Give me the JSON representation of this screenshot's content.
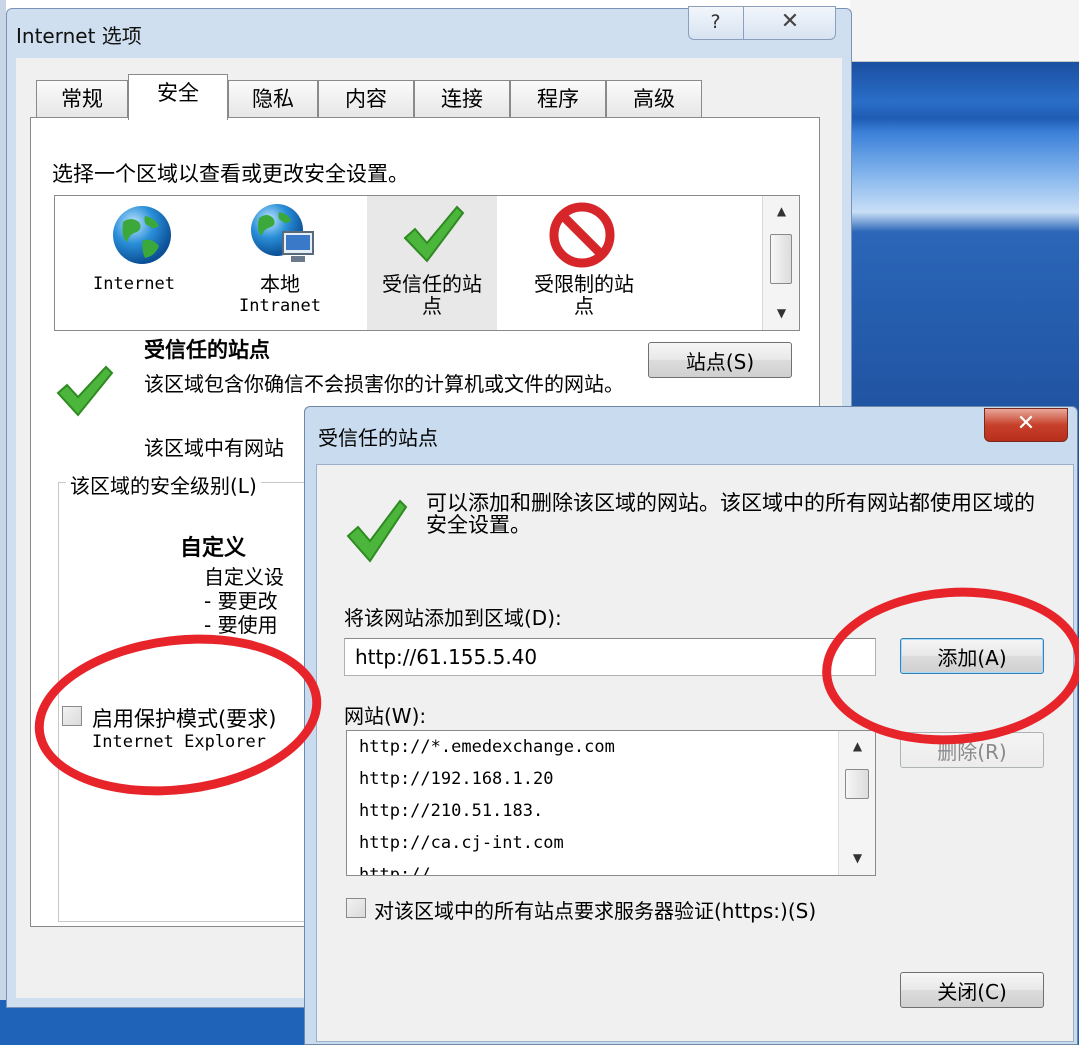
{
  "main_dialog": {
    "title": "Internet 选项",
    "help_glyph": "?",
    "close_glyph": "✕",
    "tabs": [
      {
        "label": "常规"
      },
      {
        "label": "安全"
      },
      {
        "label": "隐私"
      },
      {
        "label": "内容"
      },
      {
        "label": "连接"
      },
      {
        "label": "程序"
      },
      {
        "label": "高级"
      }
    ],
    "active_tab": "安全",
    "zone_prompt": "选择一个区域以查看或更改安全设置。",
    "zones": [
      {
        "label_line1": "Internet",
        "label_line2": "",
        "icon": "globe-icon"
      },
      {
        "label_line1": "本地",
        "label_line2": "Intranet",
        "icon": "network-globe-icon"
      },
      {
        "label_line1": "受信任的站",
        "label_line2": "点",
        "icon": "green-check-icon"
      },
      {
        "label_line1": "受限制的站",
        "label_line2": "点",
        "icon": "red-prohibited-icon"
      }
    ],
    "selected_zone": "受信任的站点",
    "section_title": "受信任的站点",
    "sites_button": "站点(S)",
    "description": "该区域包含你确信不会损害你的计算机或文件的网站。",
    "description2": "该区域中有网站",
    "security_level_label": "该区域的安全级别(L)",
    "level_title": "自定义",
    "level_lines": [
      "自定义设",
      "- 要更改",
      "- 要使用"
    ],
    "protected_mode_label": "启用保护模式(要求)",
    "protected_mode_label2": "Internet Explorer",
    "protected_mode_checked": false
  },
  "sites_dialog": {
    "title": "受信任的站点",
    "close_glyph": "✕",
    "description": "可以添加和删除该区域的网站。该区域中的所有网站都使用区域的安全设置。",
    "add_label": "将该网站添加到区域(D):",
    "url_value": "http://61.155.5.40",
    "add_button": "添加(A)",
    "websites_label": "网站(W):",
    "websites": [
      "http://*.emedexchange.com",
      "http://192.168.1.20",
      "http://210.51.183.",
      "http://ca.cj-int.com",
      "http://..."
    ],
    "remove_button": "删除(R)",
    "https_label": "对该区域中的所有站点要求服务器验证(https:)(S)",
    "https_checked": false,
    "close_button": "关闭(C)"
  },
  "colors": {
    "annotation_red": "#e8242b",
    "check_green": "#3ea62e",
    "prohibited_red": "#d7262a"
  }
}
